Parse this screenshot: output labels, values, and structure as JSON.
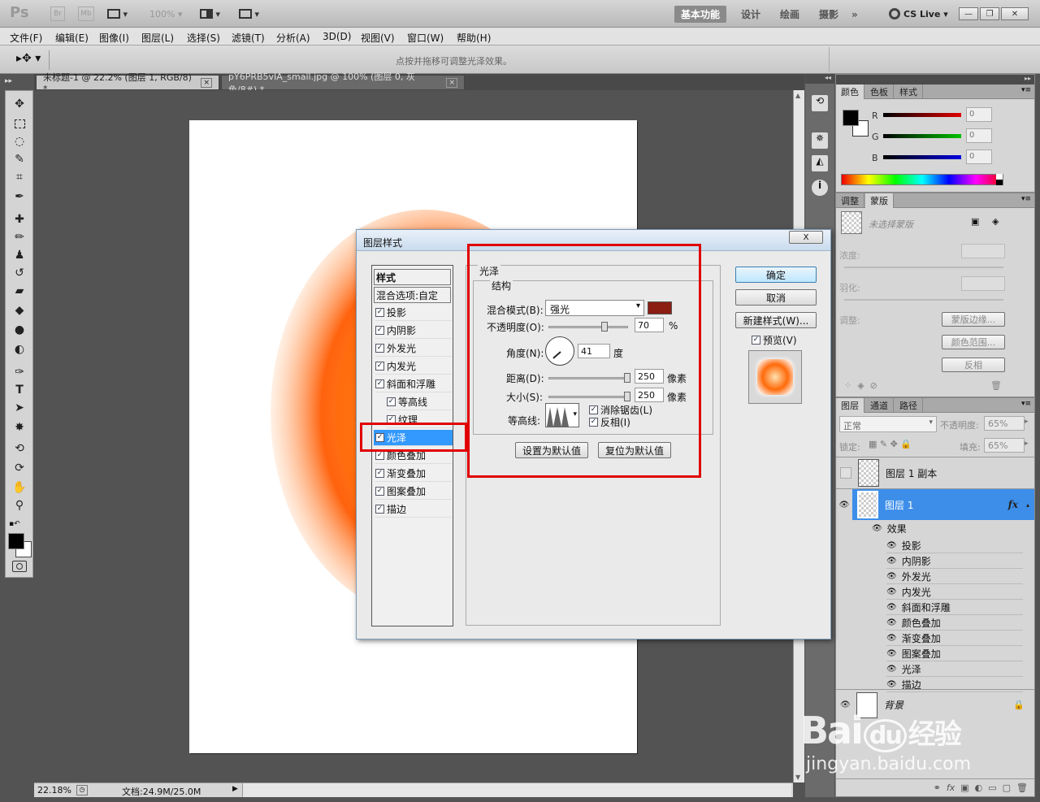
{
  "titlebar": {
    "app": "Ps",
    "br": "Br",
    "mb": "Mb",
    "zoom": "100%",
    "workspaces": [
      "基本功能",
      "设计",
      "绘画",
      "摄影"
    ],
    "more": "»",
    "cslive": "CS Live"
  },
  "menu": [
    "文件(F)",
    "编辑(E)",
    "图像(I)",
    "图层(L)",
    "选择(S)",
    "滤镜(T)",
    "分析(A)",
    "3D(D)",
    "视图(V)",
    "窗口(W)",
    "帮助(H)"
  ],
  "options": {
    "hint": "点按并拖移可调整光泽效果。"
  },
  "tabs": [
    {
      "label": "未标题-1 @ 22.2% (图层 1, RGB/8) *",
      "close": "×"
    },
    {
      "label": "pY6PRB5vIA_small.jpg @ 100% (图层 0, 灰色/8#) *",
      "close": "×"
    }
  ],
  "status": {
    "zoom": "22.18%",
    "doc": "文档:24.9M/25.0M"
  },
  "color_panel": {
    "tabs": [
      "颜色",
      "色板",
      "样式"
    ],
    "channels": [
      {
        "label": "R",
        "value": "0",
        "color": "#e00000"
      },
      {
        "label": "G",
        "value": "0",
        "color": "#00c000"
      },
      {
        "label": "B",
        "value": "0",
        "color": "#0000e0"
      }
    ]
  },
  "mask_panel": {
    "tabs": [
      "调整",
      "蒙版"
    ],
    "no_mask": "未选择蒙版",
    "density": "浓度:",
    "feather": "羽化:",
    "adjust": "调整:",
    "buttons": [
      "蒙版边缘...",
      "颜色范围...",
      "反相"
    ]
  },
  "layers_panel": {
    "tabs": [
      "图层",
      "通道",
      "路径"
    ],
    "blend": "正常",
    "opacity_label": "不透明度:",
    "opacity": "65%",
    "lock_label": "锁定:",
    "fill_label": "填充:",
    "fill": "65%",
    "layers": [
      {
        "name": "图层 1 副本"
      },
      {
        "name": "图层 1",
        "fx": "fx"
      }
    ],
    "effects_title": "效果",
    "effects": [
      "投影",
      "内阴影",
      "外发光",
      "内发光",
      "斜面和浮雕",
      "颜色叠加",
      "渐变叠加",
      "图案叠加",
      "光泽",
      "描边"
    ],
    "background": "背景"
  },
  "dialog": {
    "title": "图层样式",
    "close": "X",
    "styles_header": "样式",
    "blend_options": "混合选项:自定",
    "styles": [
      {
        "label": "投影",
        "checked": true,
        "indent": false
      },
      {
        "label": "内阴影",
        "checked": true,
        "indent": false
      },
      {
        "label": "外发光",
        "checked": true,
        "indent": false
      },
      {
        "label": "内发光",
        "checked": true,
        "indent": false
      },
      {
        "label": "斜面和浮雕",
        "checked": true,
        "indent": false
      },
      {
        "label": "等高线",
        "checked": true,
        "indent": true
      },
      {
        "label": "纹理",
        "checked": true,
        "indent": true
      },
      {
        "label": "光泽",
        "checked": true,
        "indent": false,
        "selected": true
      },
      {
        "label": "颜色叠加",
        "checked": true,
        "indent": false
      },
      {
        "label": "渐变叠加",
        "checked": true,
        "indent": false
      },
      {
        "label": "图案叠加",
        "checked": true,
        "indent": false
      },
      {
        "label": "描边",
        "checked": true,
        "indent": false
      }
    ],
    "satin": {
      "section": "光泽",
      "structure": "结构",
      "blend_mode_label": "混合模式(B):",
      "blend_mode": "强光",
      "color": "#8b1d12",
      "opacity_label": "不透明度(O):",
      "opacity": "70",
      "opacity_unit": "%",
      "angle_label": "角度(N):",
      "angle": "41",
      "angle_unit": "度",
      "distance_label": "距离(D):",
      "distance": "250",
      "size_label": "大小(S):",
      "size": "250",
      "px": "像素",
      "contour_label": "等高线:",
      "antialias": "消除锯齿(L)",
      "invert": "反相(I)",
      "make_default": "设置为默认值",
      "reset_default": "复位为默认值"
    },
    "buttons": {
      "ok": "确定",
      "cancel": "取消",
      "new_style": "新建样式(W)...",
      "preview": "预览(V)"
    }
  },
  "watermark": {
    "brand": "Bai",
    "du": "du",
    "jy": "经验",
    "url": "jingyan.baidu.com"
  }
}
